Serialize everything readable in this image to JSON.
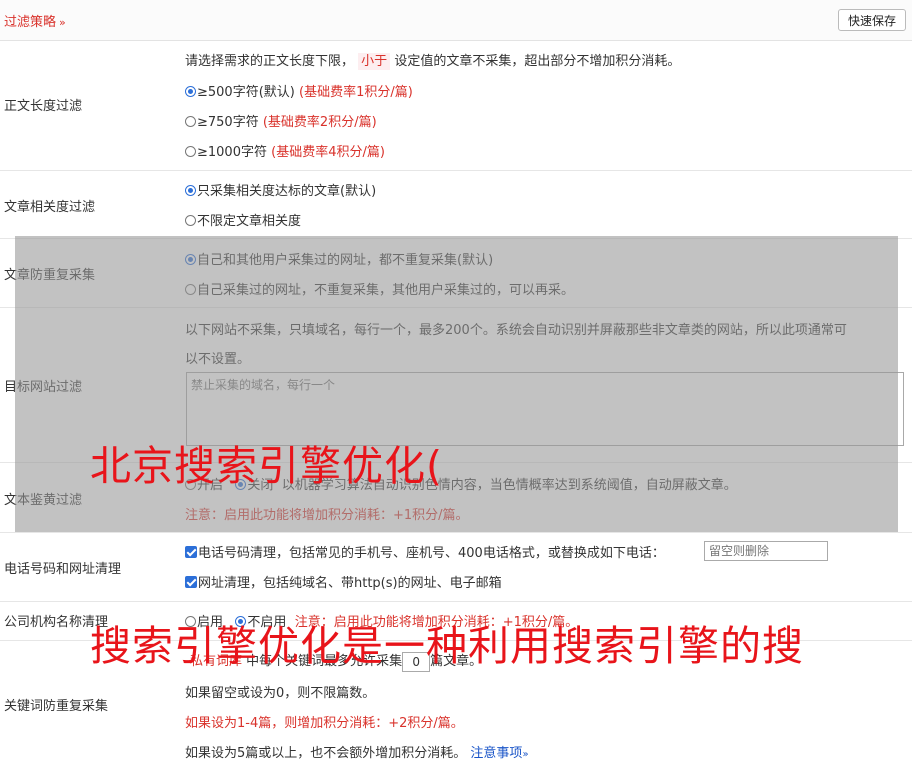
{
  "header": {
    "title": "过滤策略",
    "chevron": "»",
    "save_label": "快速保存"
  },
  "length_filter": {
    "label": "正文长度过滤",
    "desc_before": "请选择需求的正文长度下限，",
    "desc_highlight": "小于",
    "desc_after": "设定值的文章不采集，超出部分不增加积分消耗。",
    "options": [
      {
        "text": "≥500字符(默认)",
        "note": "(基础费率1积分/篇)",
        "selected": true
      },
      {
        "text": "≥750字符",
        "note": "(基础费率2积分/篇)",
        "selected": false
      },
      {
        "text": "≥1000字符",
        "note": "(基础费率4积分/篇)",
        "selected": false
      }
    ]
  },
  "relevance_filter": {
    "label": "文章相关度过滤",
    "options": [
      {
        "text": "只采集相关度达标的文章(默认)",
        "selected": true
      },
      {
        "text": "不限定文章相关度",
        "selected": false
      }
    ]
  },
  "dedupe_filter": {
    "label": "文章防重复采集",
    "options": [
      {
        "text": "自己和其他用户采集过的网址，都不重复采集(默认)",
        "selected": true
      },
      {
        "text": "自己采集过的网址，不重复采集，其他用户采集过的，可以再采。",
        "selected": false
      }
    ]
  },
  "site_filter": {
    "label": "目标网站过滤",
    "desc_line1": "以下网站不采集，只填域名，每行一个，最多200个。系统会自动识别并屏蔽那些非文章类的网站，所以此项通常可",
    "desc_line2": "以不设置。",
    "placeholder": "禁止采集的域名，每行一个"
  },
  "porn_filter": {
    "label": "文本鉴黄过滤",
    "on_label": "开启",
    "off_label": "关闭",
    "desc": "以机器学习算法自动识别色情内容，当色情概率达到系统阈值，自动屏蔽文章。",
    "warning": "注意：启用此功能将增加积分消耗：+1积分/篇。"
  },
  "phone_filter": {
    "label": "电话号码和网址清理",
    "phone_text": "电话号码清理，包括常见的手机号、座机号、400电话格式，或替换成如下电话：",
    "phone_placeholder": "留空则删除",
    "url_text": "网址清理，包括纯域名、带http(s)的网址、电子邮箱"
  },
  "company_filter": {
    "label": "公司机构名称清理",
    "on_label": "启用",
    "off_label": "不启用",
    "warning": "注意：启用此功能将增加积分消耗：+1积分/篇。"
  },
  "keyword_filter": {
    "label": "关键词防重复采集",
    "line1_prefix": "私有词库",
    "line1_mid": "中每个关键词最多允许采集",
    "count": "0",
    "line1_suffix": "篇文章。",
    "line2": "如果留空或设为0，则不限篇数。",
    "line3": "如果设为1-4篇，则增加积分消耗：+2积分/篇。",
    "line4": "如果设为5篇或以上，也不会额外增加积分消耗。",
    "notes_link": "注意事项",
    "notes_chevron": "»"
  },
  "watermarks": {
    "line1": "北京搜索引擎优化(",
    "line2": "搜索引擎优化是一种利用搜索引擎的搜"
  },
  "colors": {
    "accent_red": "#d9322b",
    "link_blue": "#1a55c8",
    "watermark_red": "#e8141a",
    "overlay_gray": "#969696"
  }
}
